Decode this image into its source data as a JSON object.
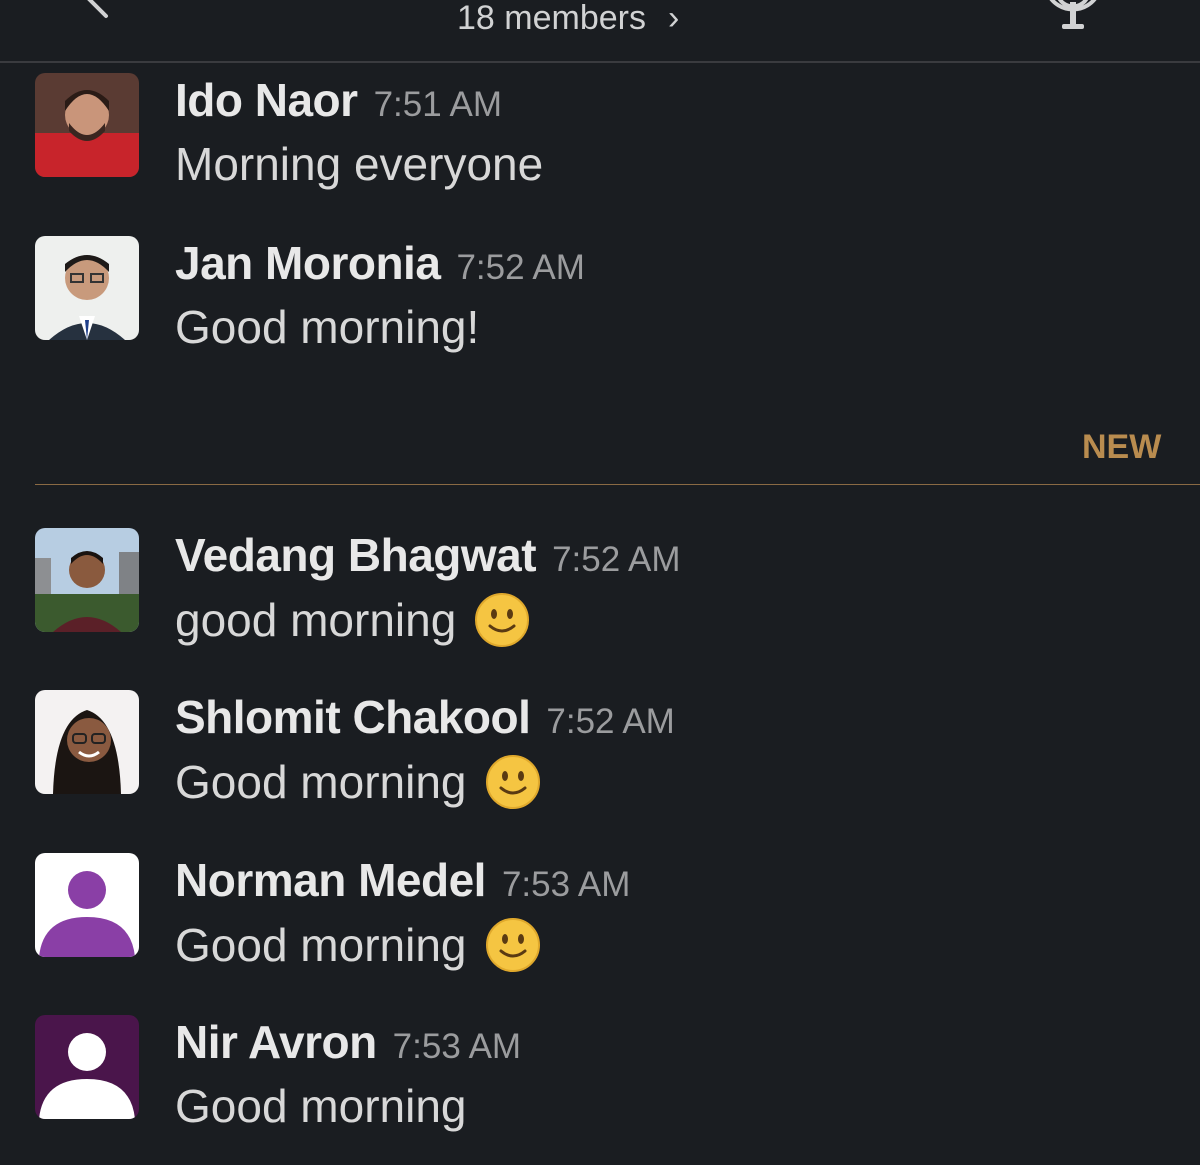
{
  "header": {
    "members_label": "18 members",
    "chevron": "›"
  },
  "new_divider_label": "NEW",
  "colors": {
    "background": "#1a1d21",
    "new_accent": "#b98c4f",
    "default_avatar_purple": "#8a3fa6",
    "default_avatar_plum": "#4a154b"
  },
  "messages": [
    {
      "name": "Ido Naor",
      "time": "7:51 AM",
      "text": "Morning everyone",
      "emoji": ""
    },
    {
      "name": "Jan Moronia",
      "time": "7:52 AM",
      "text": "Good morning!",
      "emoji": ""
    },
    {
      "name": "Vedang Bhagwat",
      "time": "7:52 AM",
      "text": "good morning",
      "emoji": "slightly-smiling-face"
    },
    {
      "name": "Shlomit Chakool",
      "time": "7:52 AM",
      "text": "Good morning",
      "emoji": "slightly-smiling-face"
    },
    {
      "name": "Norman Medel",
      "time": "7:53 AM",
      "text": "Good morning",
      "emoji": "slightly-smiling-face"
    },
    {
      "name": "Nir Avron",
      "time": "7:53 AM",
      "text": "Good morning",
      "emoji": ""
    }
  ]
}
